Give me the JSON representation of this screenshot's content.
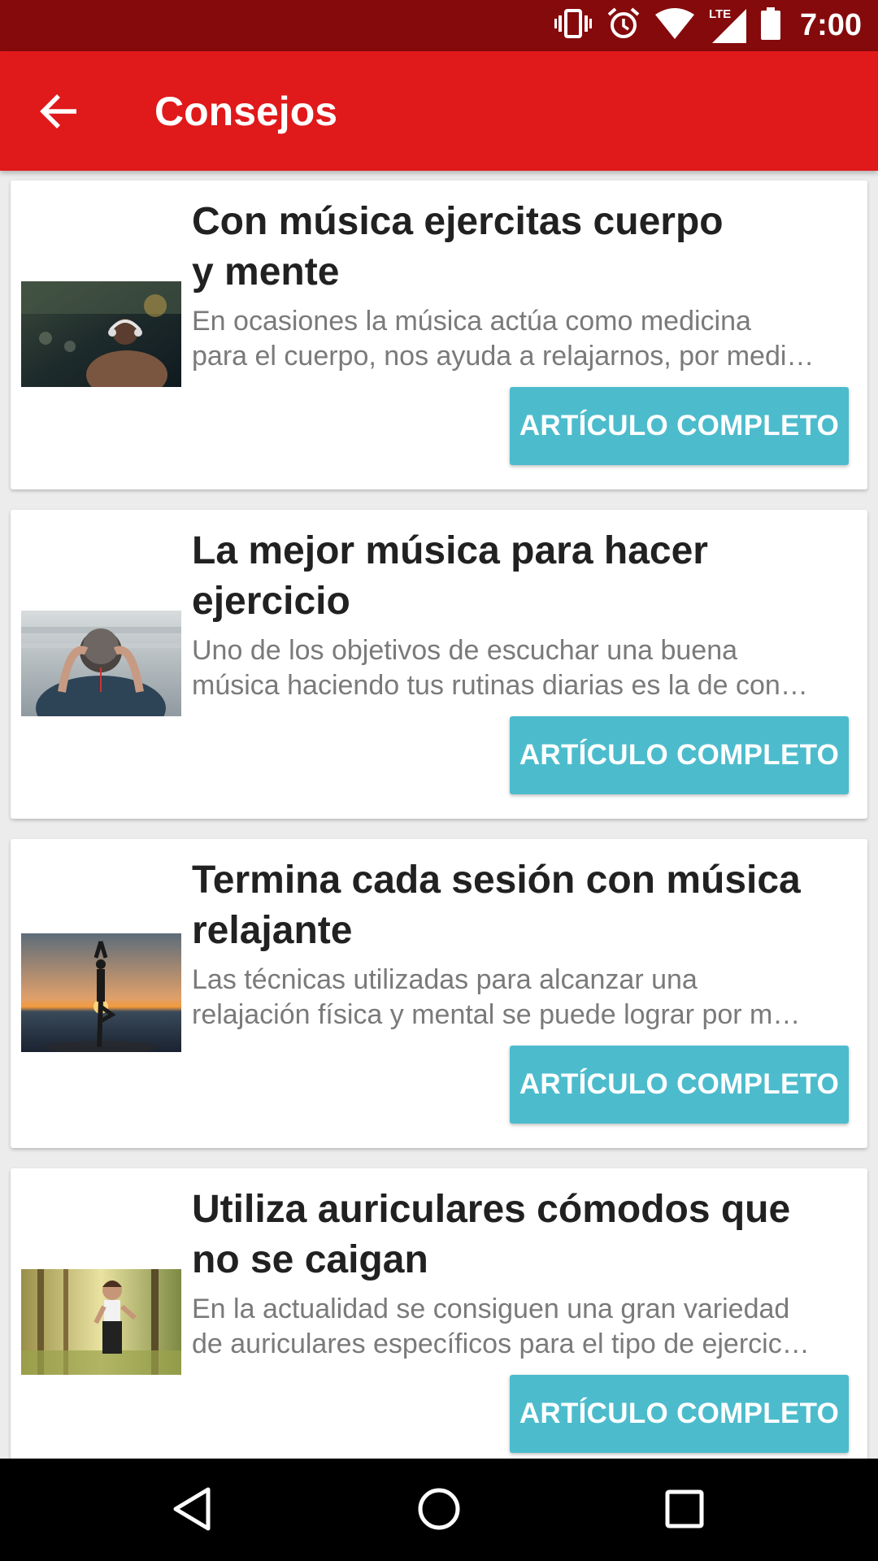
{
  "status_bar": {
    "time": "7:00",
    "icons": [
      "vibrate-icon",
      "alarm-icon",
      "wifi-icon",
      "lte-signal-icon",
      "battery-icon"
    ],
    "lte_label": "LTE"
  },
  "app_bar": {
    "title": "Consejos",
    "back_icon": "arrow-back-icon"
  },
  "articles": [
    {
      "title_lines": [
        "Con música ejercitas cuerpo",
        "y mente"
      ],
      "description_lines": [
        "En ocasiones la música actúa como medicina",
        "para el cuerpo, nos ayuda a relajarnos, por medi…"
      ],
      "button_label": "ARTÍCULO COMPLETO"
    },
    {
      "title_lines": [
        "La mejor música para hacer",
        "ejercicio"
      ],
      "description_lines": [
        "Uno de los objetivos de escuchar una buena",
        "música haciendo tus rutinas diarias es la de con…"
      ],
      "button_label": "ARTÍCULO COMPLETO"
    },
    {
      "title_lines": [
        "Termina cada sesión con música",
        "relajante"
      ],
      "description_lines": [
        "Las técnicas utilizadas para alcanzar una",
        "relajación física y mental se puede lograr por m…"
      ],
      "button_label": "ARTÍCULO COMPLETO"
    },
    {
      "title_lines": [
        "Utiliza auriculares cómodos que",
        "no se caigan"
      ],
      "description_lines": [
        "En la actualidad se consiguen una gran variedad",
        "de auriculares específicos para el tipo de ejercic…"
      ],
      "button_label": "ARTÍCULO COMPLETO"
    }
  ],
  "nav_bar": {
    "icons": [
      "back-triangle-icon",
      "home-circle-icon",
      "recents-square-icon"
    ]
  },
  "colors": {
    "status_bar": "#850a0c",
    "app_bar": "#e0191b",
    "button": "#4cbccd",
    "title_text": "#212121",
    "desc_text": "#7a7a7a"
  }
}
